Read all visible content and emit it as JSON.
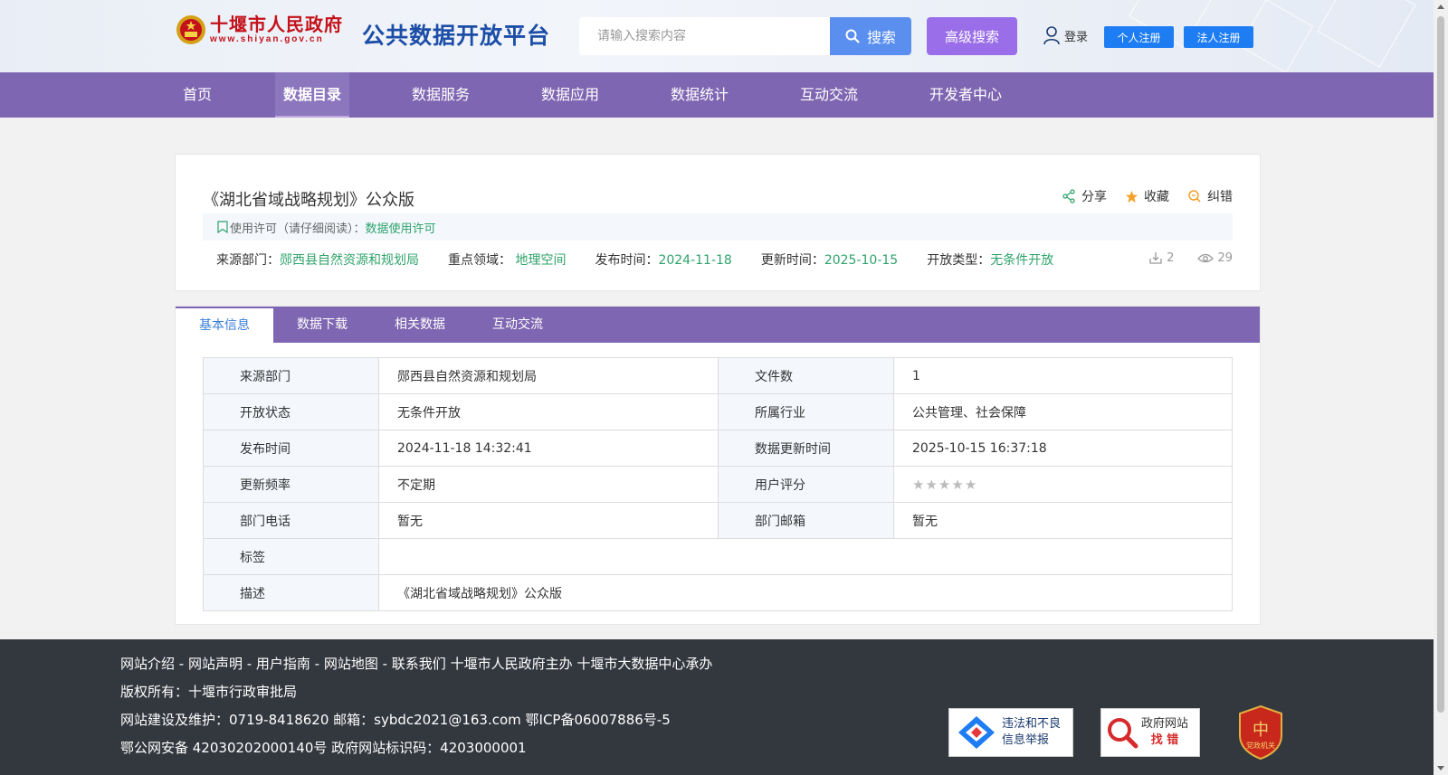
{
  "header": {
    "logo_cn": "十堰市人民政府",
    "logo_url": "www.shiyan.gov.cn",
    "platform_name": "公共数据开放平台",
    "search_placeholder": "请输入搜索内容",
    "search_label": "搜索",
    "advanced_search_label": "高级搜索",
    "login_label": "登录",
    "personal_register_label": "个人注册",
    "corporate_register_label": "法人注册"
  },
  "nav": {
    "items": [
      {
        "label": "首页"
      },
      {
        "label": "数据目录"
      },
      {
        "label": "数据服务"
      },
      {
        "label": "数据应用"
      },
      {
        "label": "数据统计"
      },
      {
        "label": "互动交流"
      },
      {
        "label": "开发者中心"
      }
    ],
    "active_index": 1
  },
  "dataset": {
    "title": "《湖北省域战略规划》公众版",
    "share_label": "分享",
    "favorite_label": "收藏",
    "correction_label": "纠错",
    "license_prefix": "使用许可（请仔细阅读）：",
    "license_link": "数据使用许可",
    "meta": {
      "source_label": "来源部门：",
      "source_value": "郧西县自然资源和规划局",
      "domain_label": "重点领域：",
      "domain_value": "地理空间",
      "publish_label": "发布时间：",
      "publish_value": "2024-11-18",
      "update_label": "更新时间：",
      "update_value": "2025-10-15",
      "open_label": "开放类型：",
      "open_value": "无条件开放"
    },
    "download_count": "2",
    "view_count": "29"
  },
  "tabs": [
    {
      "label": "基本信息"
    },
    {
      "label": "数据下载"
    },
    {
      "label": "相关数据"
    },
    {
      "label": "互动交流"
    }
  ],
  "info_table": {
    "rows": [
      {
        "l1": "来源部门",
        "v1": "郧西县自然资源和规划局",
        "l2": "文件数",
        "v2": "1"
      },
      {
        "l1": "开放状态",
        "v1": "无条件开放",
        "l2": "所属行业",
        "v2": "公共管理、社会保障"
      },
      {
        "l1": "发布时间",
        "v1": "2024-11-18 14:32:41",
        "l2": "数据更新时间",
        "v2": "2025-10-15 16:37:18"
      },
      {
        "l1": "更新频率",
        "v1": "不定期",
        "l2": "用户评分",
        "v2": ""
      },
      {
        "l1": "部门电话",
        "v1": "暂无",
        "l2": "部门邮箱",
        "v2": "暂无"
      }
    ],
    "tag_label": "标签",
    "tag_value": "",
    "desc_label": "描述",
    "desc_value": "《湖北省域战略规划》公众版",
    "rating": 0,
    "rating_max": 5
  },
  "footer": {
    "line1": "网站介绍 - 网站声明 - 用户指南 - 网站地图 - 联系我们    十堰市人民政府主办    十堰市大数据中心承办",
    "line2": "版权所有：十堰市行政审批局",
    "line3": "网站建设及维护：0719-8418620     邮箱：sybdc2021@163.com     鄂ICP备06007886号-5",
    "line4": "鄂公网安备 42030202000140号     政府网站标识码：4203000001",
    "badge1_line1": "违法和不良",
    "badge1_line2": "信息举报",
    "badge2_line1": "政府网站",
    "badge2_line2": "找 错",
    "badge3_text": "党政机关"
  },
  "colors": {
    "nav_purple": "#7f66b2",
    "accent_green": "#2fa36b",
    "search_blue": "#5a8ff0",
    "advanced_purple": "#9a6ee8",
    "register_blue": "#1e7df2",
    "footer_dark": "#33373e"
  }
}
